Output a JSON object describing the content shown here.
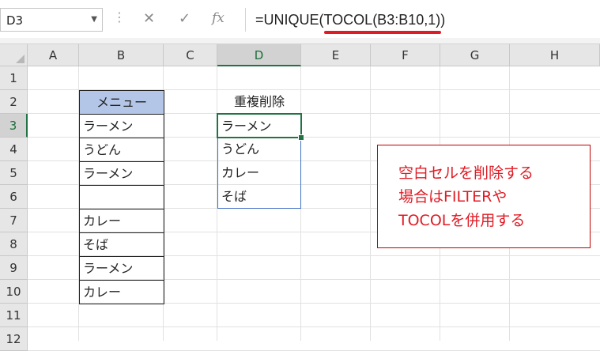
{
  "name_box": {
    "value": "D3"
  },
  "formula_bar": {
    "cancel_icon": "x-icon",
    "enter_icon": "check-icon",
    "fx_label": "fx",
    "formula": "=UNIQUE(TOCOL(B3:B10,1))"
  },
  "columns": [
    "A",
    "B",
    "C",
    "D",
    "E",
    "F",
    "G",
    "H"
  ],
  "selected_column": "D",
  "rows": [
    "1",
    "2",
    "3",
    "4",
    "5",
    "6",
    "7",
    "8",
    "9",
    "10",
    "11",
    "12"
  ],
  "selected_row": "3",
  "column_b": {
    "header": "メニュー",
    "values": [
      "ラーメン",
      "うどん",
      "ラーメン",
      "",
      "カレー",
      "そば",
      "ラーメン",
      "カレー"
    ]
  },
  "column_d": {
    "header": "重複削除",
    "values": [
      "ラーメン",
      "うどん",
      "カレー",
      "そば"
    ]
  },
  "note": {
    "lines": [
      "空白セルを削除する",
      "場合はFILTERや",
      "TOCOLを併用する"
    ],
    "color": "#e01b24"
  },
  "accent_color": "#217346"
}
